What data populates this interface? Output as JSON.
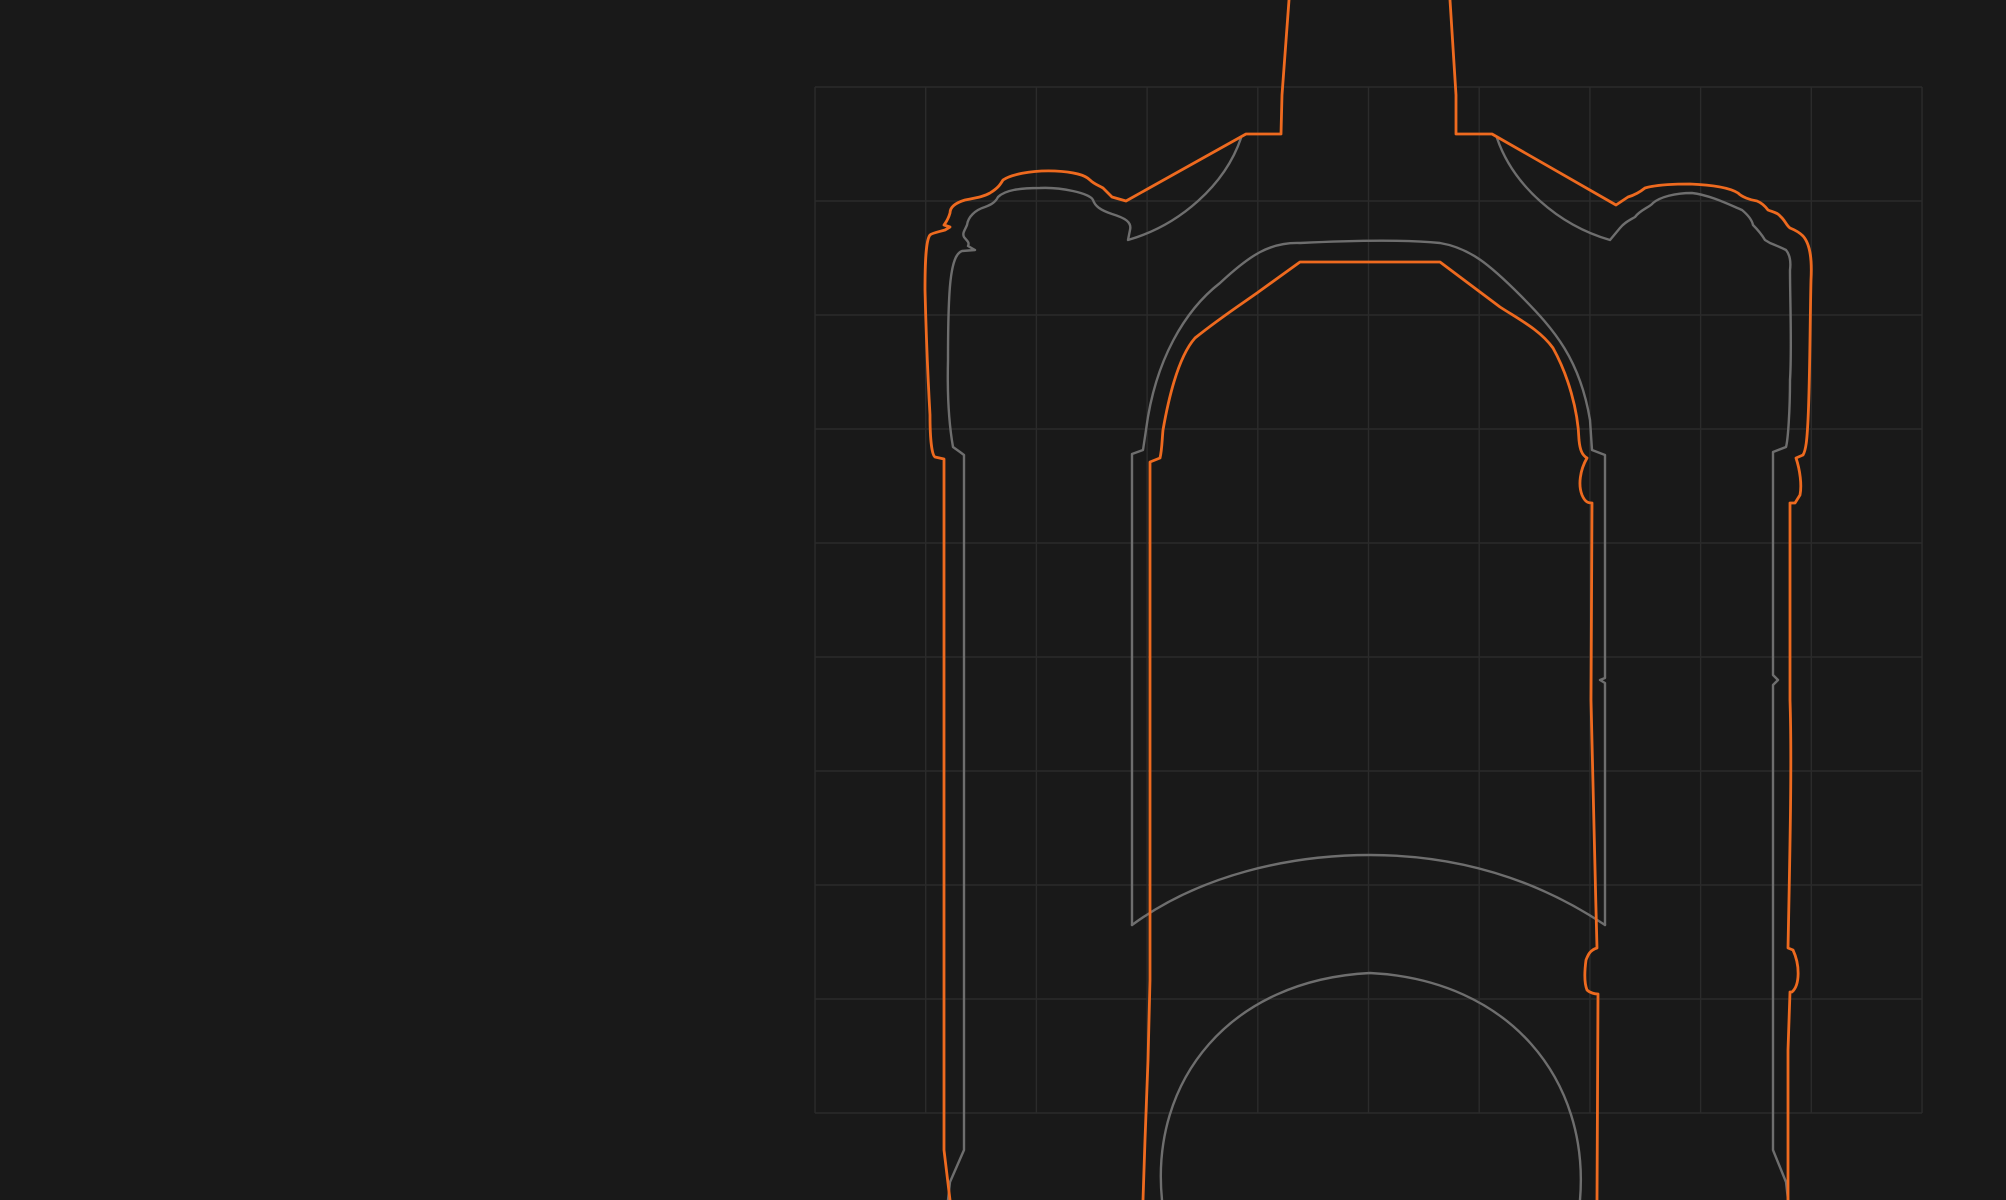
{
  "colors": {
    "background": "#191919",
    "grid": "#2b2b2b",
    "accent_outline": "#ee6a1f",
    "secondary_outline": "#6e6e6e"
  },
  "figure": {
    "subject": "fork-silhouette-technical-drawing",
    "has_grid": true,
    "grid_columns": 10,
    "grid_rows": 9
  }
}
